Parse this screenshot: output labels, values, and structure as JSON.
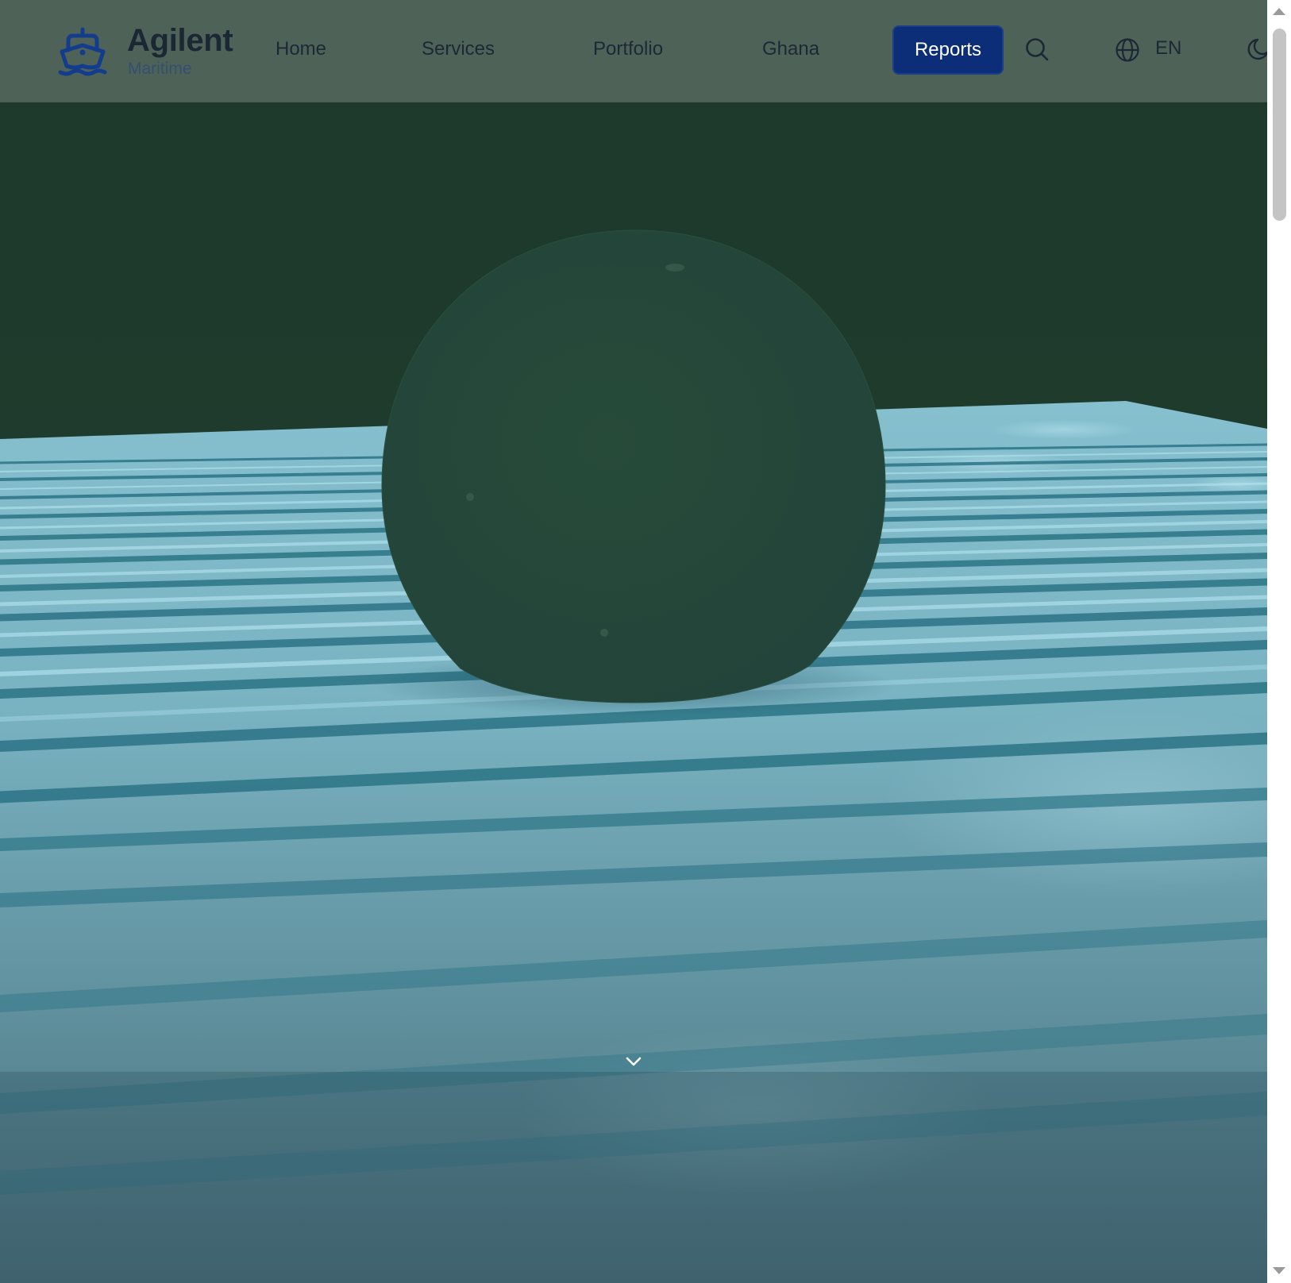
{
  "brand": {
    "name": "Agilent",
    "tagline": "Maritime",
    "logo_icon": "ship-icon",
    "accent_color": "#0c2d78"
  },
  "nav": {
    "items": [
      {
        "label": "Home"
      },
      {
        "label": "Services"
      },
      {
        "label": "Portfolio"
      },
      {
        "label": "Ghana"
      }
    ],
    "cta_label": "Reports",
    "search_icon": "search-icon",
    "language_icon": "globe-icon",
    "language_label": "EN",
    "theme_icon": "moon-icon"
  },
  "hero": {
    "background": "3d-water-scene",
    "scroll_icon": "chevron-down-icon",
    "colors": {
      "sky": "#1f3a2c",
      "sphere": "#264a39",
      "water": "#7ab3c2"
    }
  }
}
